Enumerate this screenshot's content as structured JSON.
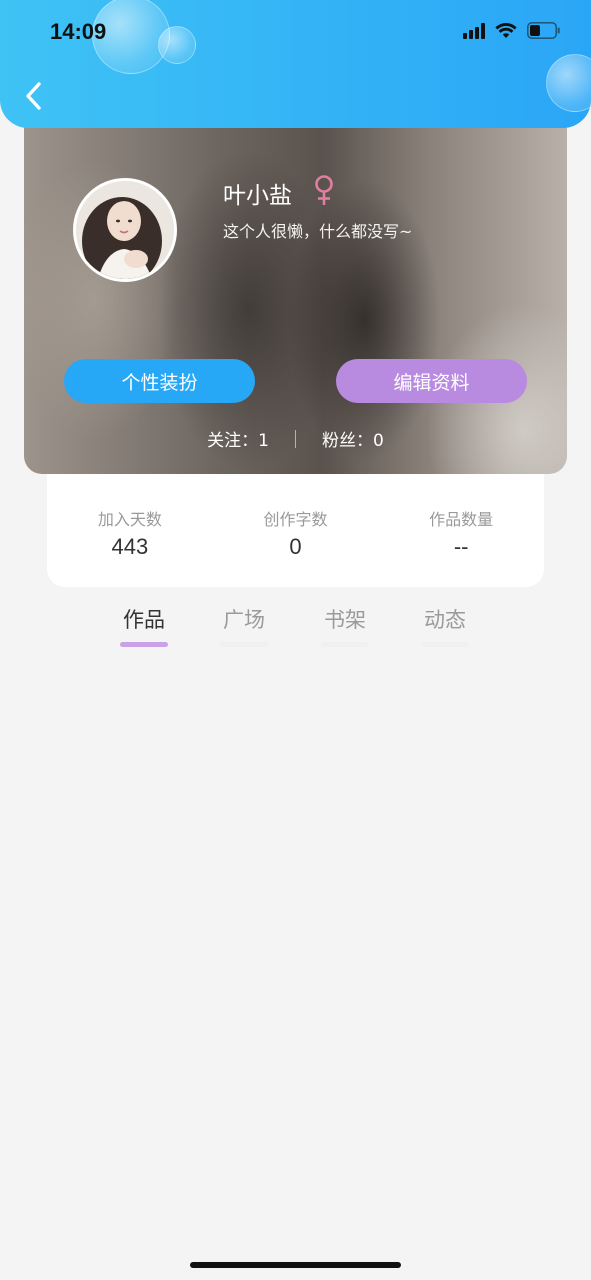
{
  "status_bar": {
    "time": "14:09"
  },
  "profile": {
    "name": "叶小盐",
    "gender_symbol": "♀",
    "bio": "这个人很懒，什么都没写~",
    "decorate_button": "个性装扮",
    "edit_button": "编辑资料",
    "following_label": "关注：1",
    "followers_label": "粉丝：0"
  },
  "stats": [
    {
      "label": "加入天数",
      "value": "443"
    },
    {
      "label": "创作字数",
      "value": "0"
    },
    {
      "label": "作品数量",
      "value": "--"
    }
  ],
  "tabs": [
    {
      "label": "作品",
      "active": true
    },
    {
      "label": "广场",
      "active": false
    },
    {
      "label": "书架",
      "active": false
    },
    {
      "label": "动态",
      "active": false
    }
  ],
  "colors": {
    "header_start": "#3fc3f5",
    "header_end": "#2aa6f6",
    "decorate_button": "#27a8f6",
    "edit_button": "#b88be0",
    "tab_underline_active": "#c8a4e6",
    "gender_icon": "#e07fa0"
  }
}
